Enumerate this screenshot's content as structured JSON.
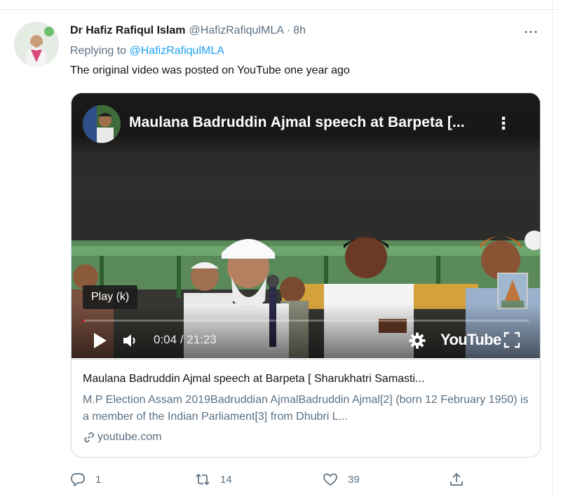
{
  "tweet": {
    "author_name": "Dr Hafiz Rafiqul Islam",
    "author_handle": "@HafizRafiqulMLA",
    "separator": "·",
    "time": "8h",
    "more_icon": "more-dots-icon",
    "replying_prefix": "Replying to ",
    "replying_to": "@HafizRafiqulMLA",
    "text": "The original video was posted on YouTube one year ago"
  },
  "video": {
    "title": "Maulana Badruddin Ajmal speech at Barpeta [...",
    "tooltip": "Play (k)",
    "time_current": "0:04",
    "time_separator": " / ",
    "time_total": "21:23",
    "progress_fraction": 0.003,
    "logo_text": "YouTube",
    "progress_color": "#ff0000"
  },
  "card": {
    "title": "Maulana Badruddin Ajmal speech at Barpeta [ Sharukhatri Samasti...",
    "description": "M.P Election Assam 2019Badruddian AjmalBadruddin Ajmal[2] (born 12 February 1950) is a member of the Indian Parliament[3] from Dhubri L...",
    "domain": "youtube.com"
  },
  "actions": {
    "reply_count": "1",
    "retweet_count": "14",
    "like_count": "39"
  },
  "colors": {
    "link": "#1da1f2",
    "secondary_text": "#5b7083",
    "border": "#cfd9de"
  }
}
